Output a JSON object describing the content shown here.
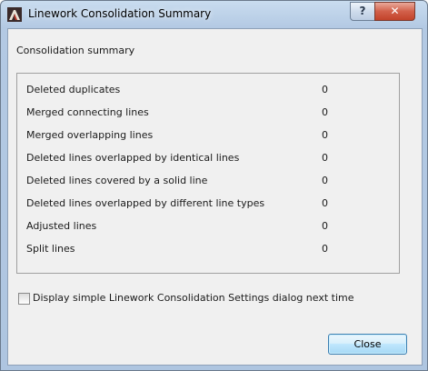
{
  "window": {
    "title": "Linework Consolidation Summary",
    "help_label": "?",
    "close_label": "✕"
  },
  "main": {
    "heading": "Consolidation summary",
    "rows": [
      {
        "label": "Deleted duplicates",
        "value": "0"
      },
      {
        "label": "Merged connecting lines",
        "value": "0"
      },
      {
        "label": "Merged overlapping lines",
        "value": "0"
      },
      {
        "label": "Deleted lines overlapped by identical lines",
        "value": "0"
      },
      {
        "label": "Deleted lines covered by a solid line",
        "value": "0"
      },
      {
        "label": "Deleted lines overlapped by different line types",
        "value": "0"
      },
      {
        "label": "Adjusted lines",
        "value": "0"
      },
      {
        "label": "Split lines",
        "value": "0"
      }
    ],
    "checkbox": {
      "label": "Display simple Linework Consolidation Settings dialog next time",
      "checked": false
    },
    "close_button_label": "Close"
  }
}
